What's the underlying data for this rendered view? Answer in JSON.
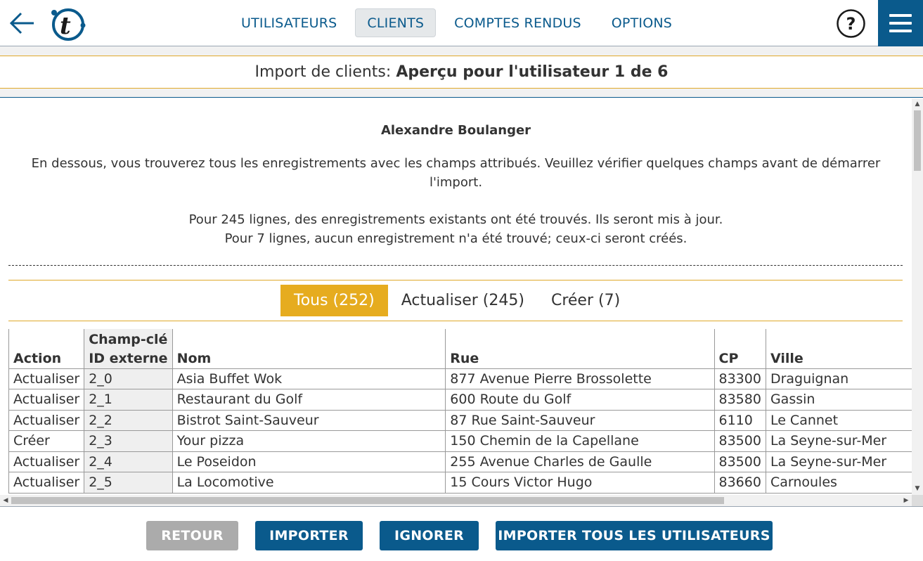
{
  "header": {
    "nav": [
      {
        "label": "UTILISATEURS",
        "active": false
      },
      {
        "label": "CLIENTS",
        "active": true
      },
      {
        "label": "COMPTES RENDUS",
        "active": false
      },
      {
        "label": "OPTIONS",
        "active": false
      }
    ],
    "icons": [
      "back-arrow-icon",
      "logo-icon",
      "help-icon",
      "menu-icon"
    ]
  },
  "title": {
    "prefix": "Import de clients:",
    "main": "Aperçu pour l'utilisateur 1 de 6"
  },
  "content": {
    "user_name": "Alexandre Boulanger",
    "intro": "En dessous, vous trouverez tous les enregistrements avec les champs attribués. Veuillez vérifier quelques champs avant de démarrer l'import.",
    "stats_update": "Pour 245 lignes, des enregistrements existants ont été trouvés. Ils seront mis à jour.",
    "stats_create": "Pour 7 lignes, aucun enregistrement n'a été trouvé; ceux-ci seront créés."
  },
  "tabs": [
    {
      "label": "Tous (252)",
      "active": true
    },
    {
      "label": "Actualiser (245)",
      "active": false
    },
    {
      "label": "Créer (7)",
      "active": false
    }
  ],
  "table": {
    "headers": {
      "action": "Action",
      "key_line1": "Champ-clé",
      "key_line2": "ID externe",
      "nom": "Nom",
      "rue": "Rue",
      "cp": "CP",
      "ville": "Ville"
    },
    "rows": [
      {
        "action": "Actualiser",
        "key": "2_0",
        "nom": "Asia Buffet Wok",
        "rue": "877 Avenue Pierre Brossolette",
        "cp": "83300",
        "ville": "Draguignan"
      },
      {
        "action": "Actualiser",
        "key": "2_1",
        "nom": "Restaurant du Golf",
        "rue": "600 Route du Golf",
        "cp": "83580",
        "ville": "Gassin"
      },
      {
        "action": "Actualiser",
        "key": "2_2",
        "nom": "Bistrot Saint-Sauveur",
        "rue": "87 Rue Saint-Sauveur",
        "cp": "6110",
        "ville": "Le Cannet"
      },
      {
        "action": "Créer",
        "key": "2_3",
        "nom": "Your pizza",
        "rue": "150 Chemin de la Capellane",
        "cp": "83500",
        "ville": "La Seyne-sur-Mer"
      },
      {
        "action": "Actualiser",
        "key": "2_4",
        "nom": "Le Poseidon",
        "rue": "255 Avenue Charles de Gaulle",
        "cp": "83500",
        "ville": "La Seyne-sur-Mer"
      },
      {
        "action": "Actualiser",
        "key": "2_5",
        "nom": "La Locomotive",
        "rue": "15 Cours Victor Hugo",
        "cp": "83660",
        "ville": "Carnoules"
      }
    ]
  },
  "footer": {
    "retour": "RETOUR",
    "importer": "IMPORTER",
    "ignorer": "IGNORER",
    "importer_tous": "IMPORTER TOUS LES UTILISATEURS",
    "retour_disabled": true
  },
  "colors": {
    "primary": "#0a5a8c",
    "accent": "#e6ac1f",
    "disabled": "#ababab"
  }
}
